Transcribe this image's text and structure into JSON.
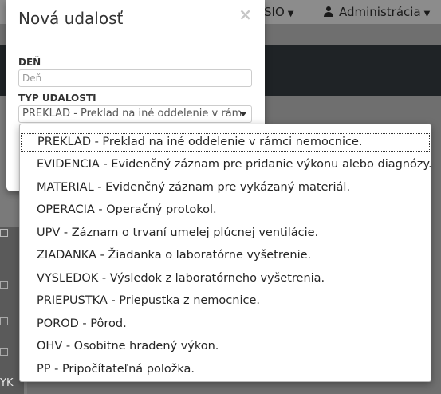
{
  "background": {
    "nav_items": [
      {
        "label": "SIO"
      },
      {
        "label": "Administrácia"
      }
    ],
    "left_text": "YK"
  },
  "modal": {
    "title": "Nová udalosť",
    "close_label": "×",
    "den_label": "DEŇ",
    "den_placeholder": "Deň",
    "den_value": "",
    "typ_label": "TYP UDALOSTI",
    "typ_selected": "PREKLAD - Preklad na iné oddelenie v rám"
  },
  "dropdown": {
    "options": [
      {
        "label": "PREKLAD - Preklad na iné oddelenie v rámci nemocnice.",
        "selected": true
      },
      {
        "label": "EVIDENCIA - Evidenčný záznam pre pridanie výkonu alebo diagnózy.",
        "selected": false
      },
      {
        "label": "MATERIAL - Evidenčný záznam pre vykázaný materiál.",
        "selected": false
      },
      {
        "label": "OPERACIA - Operačný protokol.",
        "selected": false
      },
      {
        "label": "UPV - Záznam o trvaní umelej plúcnej ventilácie.",
        "selected": false
      },
      {
        "label": "ZIADANKA - Žiadanka o laboratórne vyšetrenie.",
        "selected": false
      },
      {
        "label": "VYSLEDOK - Výsledok z laboratórneho vyšetrenia.",
        "selected": false
      },
      {
        "label": "PRIEPUSTKA - Priepustka z nemocnice.",
        "selected": false
      },
      {
        "label": "POROD - Pôrod.",
        "selected": false
      },
      {
        "label": "OHV - Osobitne hradený výkon.",
        "selected": false
      },
      {
        "label": "PP - Pripočítateľná položka.",
        "selected": false
      }
    ]
  }
}
